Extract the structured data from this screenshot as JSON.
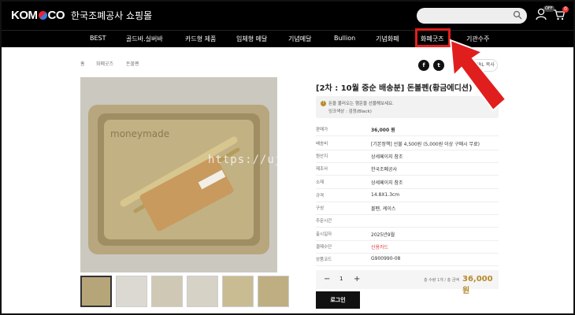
{
  "header": {
    "logo_text": "KOMSCO",
    "brand_kr": "한국조폐공사 쇼핑몰",
    "search_placeholder": "",
    "off_badge": "OFF",
    "cart_count": "0"
  },
  "nav": {
    "items": [
      "BEST",
      "골드바.실버바",
      "카드형 제품",
      "입체형 메달",
      "기념메달",
      "Bullion",
      "기념화폐",
      "화폐굿즈",
      "기관수주"
    ],
    "active_index": 7
  },
  "breadcrumb": [
    "홈",
    "화폐굿즈",
    "돈볼펜"
  ],
  "share": {
    "facebook": "f",
    "twitter": "t",
    "url_copy": "URL 복사"
  },
  "product": {
    "title": "[2차 : 10월 중순 배송분] 돈볼펜(황금에디션)",
    "notice_lines": [
      "돈을 불러오는 행운을 선물해보세요.",
      "잉크색상 : 검정(Black)"
    ],
    "info": [
      {
        "label": "판매가",
        "value": "36,000 원"
      },
      {
        "label": "배송비",
        "value": "[기본정책] 선불 4,500원 (5,000원 이상 구매시 무료)"
      },
      {
        "label": "원산지",
        "value": "상세페이지 참조"
      },
      {
        "label": "제조사",
        "value": "한국조폐공사"
      },
      {
        "label": "소재",
        "value": "상세페이지 참조"
      },
      {
        "label": "규격",
        "value": "14.8X1.3cm"
      },
      {
        "label": "구성",
        "value": "볼펜, 케이스"
      },
      {
        "label": "주문시간",
        "value": ""
      },
      {
        "label": "출시일자",
        "value": "2025년9월"
      },
      {
        "label": "결제수단",
        "value": "신용카드"
      },
      {
        "label": "상품코드",
        "value": "G900990-08"
      }
    ],
    "quantity": "1",
    "total_label": "총 수량 1개 / 총 금액",
    "total_price": "36,000 원",
    "login_button": "로그인"
  },
  "watermark": "https://ujuland.tistory.com",
  "colors": {
    "accent": "#b58a2a",
    "highlight": "#e01e1e",
    "header_bg": "#000000"
  }
}
